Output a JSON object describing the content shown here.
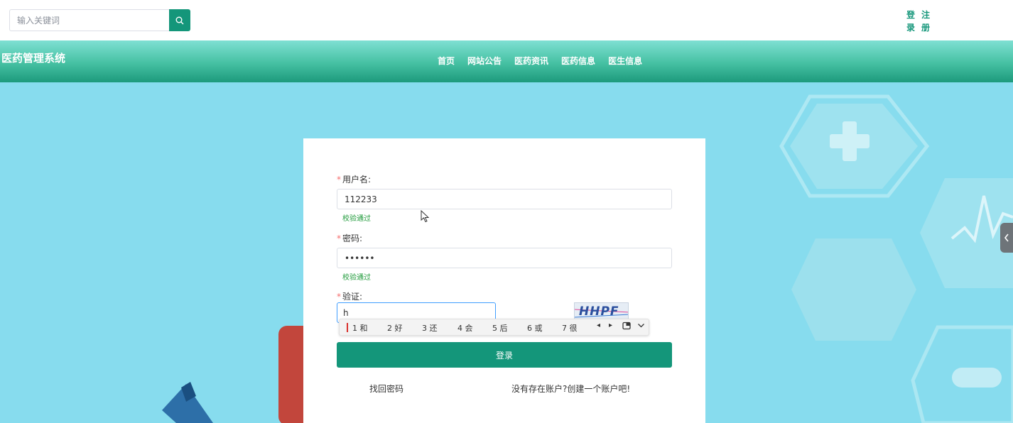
{
  "header": {
    "search_placeholder": "输入关键词",
    "login_label": "登录",
    "register_label": "注册"
  },
  "nav": {
    "brand": "医药管理系统",
    "items": [
      "首页",
      "网站公告",
      "医药资讯",
      "医药信息",
      "医生信息"
    ]
  },
  "login_form": {
    "username_label": "用户名:",
    "username_value": "112233",
    "username_status": "校验通过",
    "password_label": "密码:",
    "password_value": "••••••",
    "password_status": "校验通过",
    "captcha_label": "验证:",
    "captcha_value": "h",
    "captcha_image_text": "HHPF",
    "submit_label": "登录",
    "forgot_link": "找回密码",
    "register_link": "没有存在账户?创建一个账户吧!"
  },
  "ime": {
    "candidates": [
      "1 和",
      "2 好",
      "3 还",
      "4 会",
      "5 后",
      "6 或",
      "7 很"
    ]
  },
  "colors": {
    "primary": "#14967a",
    "background": "#87dcee",
    "required": "#f56c6c",
    "success": "#1f9a3a"
  }
}
